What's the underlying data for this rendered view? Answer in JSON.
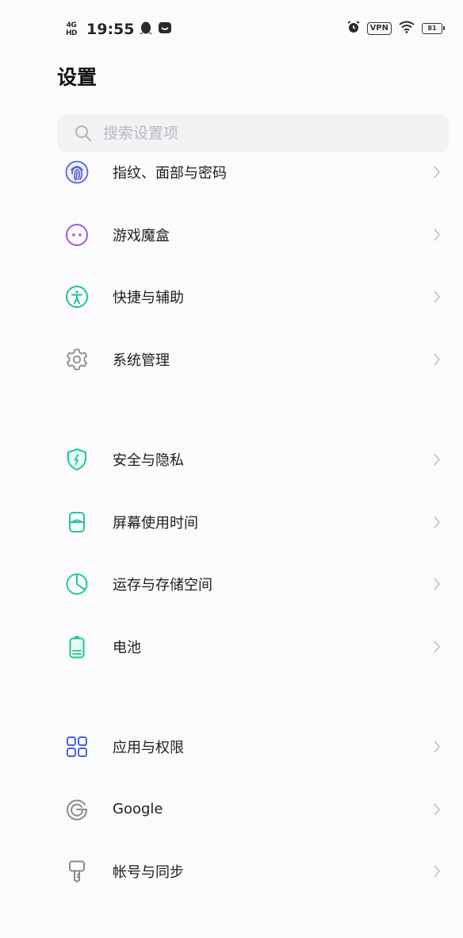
{
  "status_bar": {
    "signal_text_top": "4G",
    "signal_text_bottom": "HD",
    "time": "19:55",
    "vpn_label": "VPN",
    "battery_level": "81",
    "icons": [
      "alarm-icon",
      "wifi-icon",
      "penguin-icon",
      "message-icon"
    ]
  },
  "header": {
    "title": "设置"
  },
  "search": {
    "placeholder": "搜索设置项",
    "value": ""
  },
  "groups": [
    {
      "items": [
        {
          "label": "指纹、面部与密码",
          "icon": "fingerprint-icon",
          "color": "#5a63d4"
        },
        {
          "label": "游戏魔盒",
          "icon": "game-icon",
          "color": "#a35bd8"
        },
        {
          "label": "快捷与辅助",
          "icon": "accessibility-icon",
          "color": "#1fc2a0"
        },
        {
          "label": "系统管理",
          "icon": "gear-icon",
          "color": "#8a8a8f"
        }
      ]
    },
    {
      "items": [
        {
          "label": "安全与隐私",
          "icon": "shield-icon",
          "color": "#24c69a"
        },
        {
          "label": "屏幕使用时间",
          "icon": "hourglass-icon",
          "color": "#24c69a"
        },
        {
          "label": "运存与存储空间",
          "icon": "pie-chart-icon",
          "color": "#24c69a"
        },
        {
          "label": "电池",
          "icon": "battery-icon",
          "color": "#24c69a"
        }
      ]
    },
    {
      "items": [
        {
          "label": "应用与权限",
          "icon": "apps-grid-icon",
          "color": "#4b63d6"
        },
        {
          "label": "Google",
          "icon": "google-icon",
          "color": "#8a8a8f"
        },
        {
          "label": "帐号与同步",
          "icon": "key-icon",
          "color": "#8a8a8f"
        }
      ]
    }
  ],
  "chevron_color": "#b8b8bd"
}
